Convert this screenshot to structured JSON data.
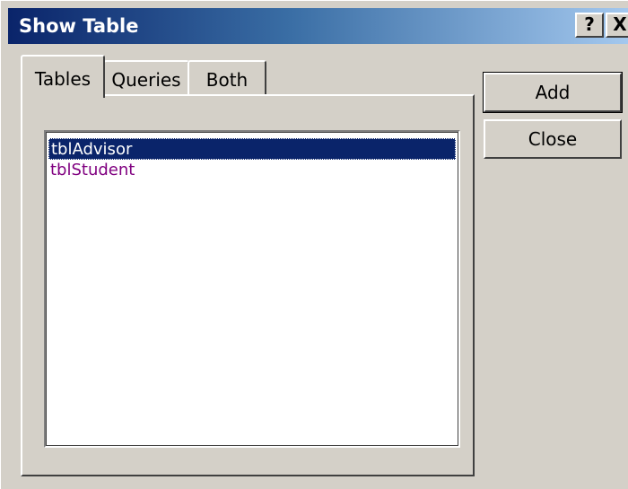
{
  "window": {
    "title": "Show Table",
    "help_glyph": "?",
    "close_glyph": "X"
  },
  "tabs": [
    {
      "label": "Tables",
      "active": true
    },
    {
      "label": "Queries",
      "active": false
    },
    {
      "label": "Both",
      "active": false
    }
  ],
  "list": {
    "items": [
      {
        "label": "tblAdvisor",
        "selected": true
      },
      {
        "label": "tblStudent",
        "selected": false
      }
    ]
  },
  "buttons": {
    "add_label": "Add",
    "close_label": "Close"
  },
  "colors": {
    "titlebar_start": "#0a246a",
    "titlebar_end": "#a6caf0",
    "selection": "#0a246a",
    "item_text": "#800080",
    "face": "#d4d0c8"
  }
}
